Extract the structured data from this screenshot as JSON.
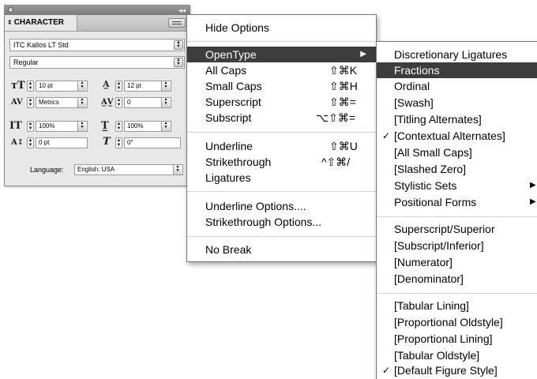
{
  "panel": {
    "tab_label": "CHARACTER",
    "collapse_glyph": "◂◂",
    "font_family": "ITC Kallos LT Std",
    "font_style": "Regular",
    "font_size": "10 pt",
    "leading": "12 pt",
    "kerning": "Metrics",
    "tracking": "0",
    "vertical_scale": "100%",
    "horizontal_scale": "100%",
    "baseline_shift": "0 pt",
    "skew": "0°",
    "language_label": "Language:",
    "language_value": "English: USA"
  },
  "main_menu": {
    "items": [
      {
        "label": "Hide Options"
      },
      {
        "label": "OpenType",
        "submenu": "▶",
        "highlighted": true
      },
      {
        "label": "All Caps",
        "shortcut": "⇧⌘K"
      },
      {
        "label": "Small Caps",
        "shortcut": "⇧⌘H"
      },
      {
        "label": "Superscript",
        "shortcut": "⇧⌘="
      },
      {
        "label": "Subscript",
        "shortcut": "⌥⇧⌘="
      },
      {
        "label": "Underline",
        "shortcut": "⇧⌘U"
      },
      {
        "label": "Strikethrough",
        "shortcut": "^⇧⌘/"
      },
      {
        "label": "Ligatures"
      },
      {
        "label": "Underline Options...."
      },
      {
        "label": "Strikethrough Options..."
      },
      {
        "label": "No Break"
      }
    ]
  },
  "opentype_menu": {
    "items": [
      {
        "label": "Discretionary Ligatures"
      },
      {
        "label": "Fractions",
        "highlighted": true
      },
      {
        "label": "Ordinal"
      },
      {
        "label": "[Swash]"
      },
      {
        "label": "[Titling Alternates]"
      },
      {
        "label": "[Contextual Alternates]",
        "checked": true
      },
      {
        "label": "[All Small Caps]"
      },
      {
        "label": "[Slashed Zero]"
      },
      {
        "label": "Stylistic Sets",
        "submenu": "▶"
      },
      {
        "label": "Positional Forms",
        "submenu": "▶"
      },
      {
        "label": "Superscript/Superior"
      },
      {
        "label": "[Subscript/Inferior]"
      },
      {
        "label": "[Numerator]"
      },
      {
        "label": "[Denominator]"
      },
      {
        "label": "[Tabular Lining]"
      },
      {
        "label": "[Proportional Oldstyle]"
      },
      {
        "label": "[Proportional Lining]"
      },
      {
        "label": "[Tabular Oldstyle]"
      },
      {
        "label": "[Default Figure Style]",
        "checked": true
      }
    ],
    "check_glyph": "✓"
  },
  "colors": {
    "highlight": "#3d3d3d",
    "panel_bg": "#e8e8e8"
  }
}
